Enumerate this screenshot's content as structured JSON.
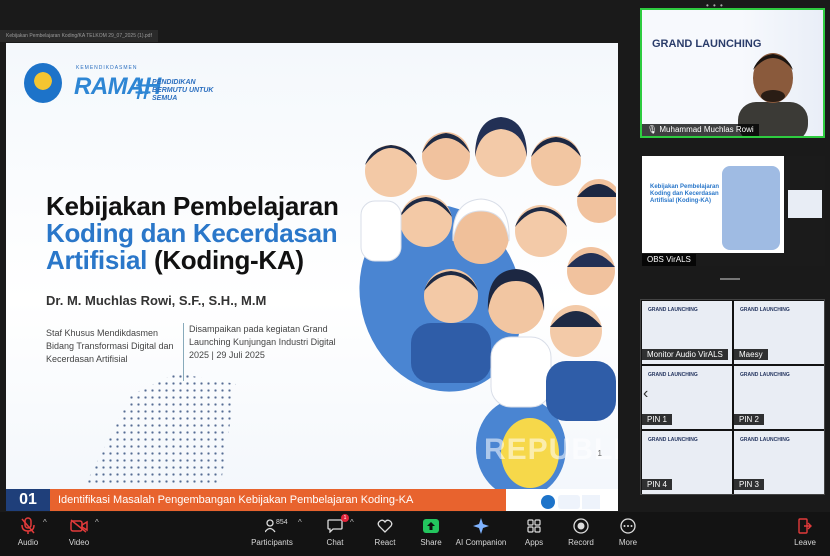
{
  "window": {
    "file_tab": "Kebijakan Pembelajaran Koding/KA TELKOM 29_07_2025 (1).pdf"
  },
  "slide": {
    "logo_subtitle": "KEMENDIKDASMEN",
    "logo_text": "RAMAH",
    "hashtag": "#",
    "tagline": "PENDIDIKAN BERMUTU UNTUK SEMUA",
    "title_line1": "Kebijakan Pembelajaran",
    "title_line2": "Koding dan Kecerdasan",
    "title_line3a": "Artifisial",
    "title_line3b": " (Koding-KA)",
    "author": "Dr. M. Muchlas Rowi, S.F., S.H., M.M",
    "role": "Staf Khusus Mendikdasmen Bidang Transformasi Digital dan Kecerdasan Artifisial",
    "event": "Disampaikan pada kegiatan Grand Launching Kunjungan Industri Digital 2025 | 29 Juli 2025",
    "page_number": "1",
    "watermark": "REPUBLIKA"
  },
  "next_slide_strip": {
    "number": "01",
    "title": "Identifikasi Masalah Pengembangan Kebijakan Pembelajaran Koding-KA"
  },
  "participants": {
    "speaker": {
      "name": "Muhammad Muchlas Rowi",
      "background_text": "GRAND LAUNCHING"
    },
    "obs": {
      "name": "OBS VirALS",
      "slide_title": "Kebijakan Pembelajaran Koding dan Kecerdasan Artifisial (Koding-KA)"
    },
    "grid": [
      {
        "name": "Monitor Audio VirALS",
        "bg": "GRAND LAUNCHING"
      },
      {
        "name": "Maesy",
        "bg": "GRAND LAUNCHING"
      },
      {
        "name": "PIN 1",
        "bg": "GRAND LAUNCHING"
      },
      {
        "name": "PIN 2",
        "bg": "GRAND LAUNCHING"
      },
      {
        "name": "PIN 4",
        "bg": "GRAND LAUNCHING"
      },
      {
        "name": "PIN 3",
        "bg": "GRAND LAUNCHING"
      }
    ]
  },
  "toolbar": {
    "audio": "Audio",
    "video": "Video",
    "participants": "Participants",
    "participants_count": "854",
    "chat": "Chat",
    "chat_badge": "1",
    "react": "React",
    "share": "Share",
    "ai_companion": "AI Companion",
    "apps": "Apps",
    "record": "Record",
    "more": "More",
    "leave": "Leave"
  },
  "colors": {
    "accent_green": "#2ecc40",
    "share_green": "#23c55e",
    "slide_blue": "#2a77c9",
    "strip_orange": "#e8632e",
    "strip_navy": "#1f3f7a"
  }
}
